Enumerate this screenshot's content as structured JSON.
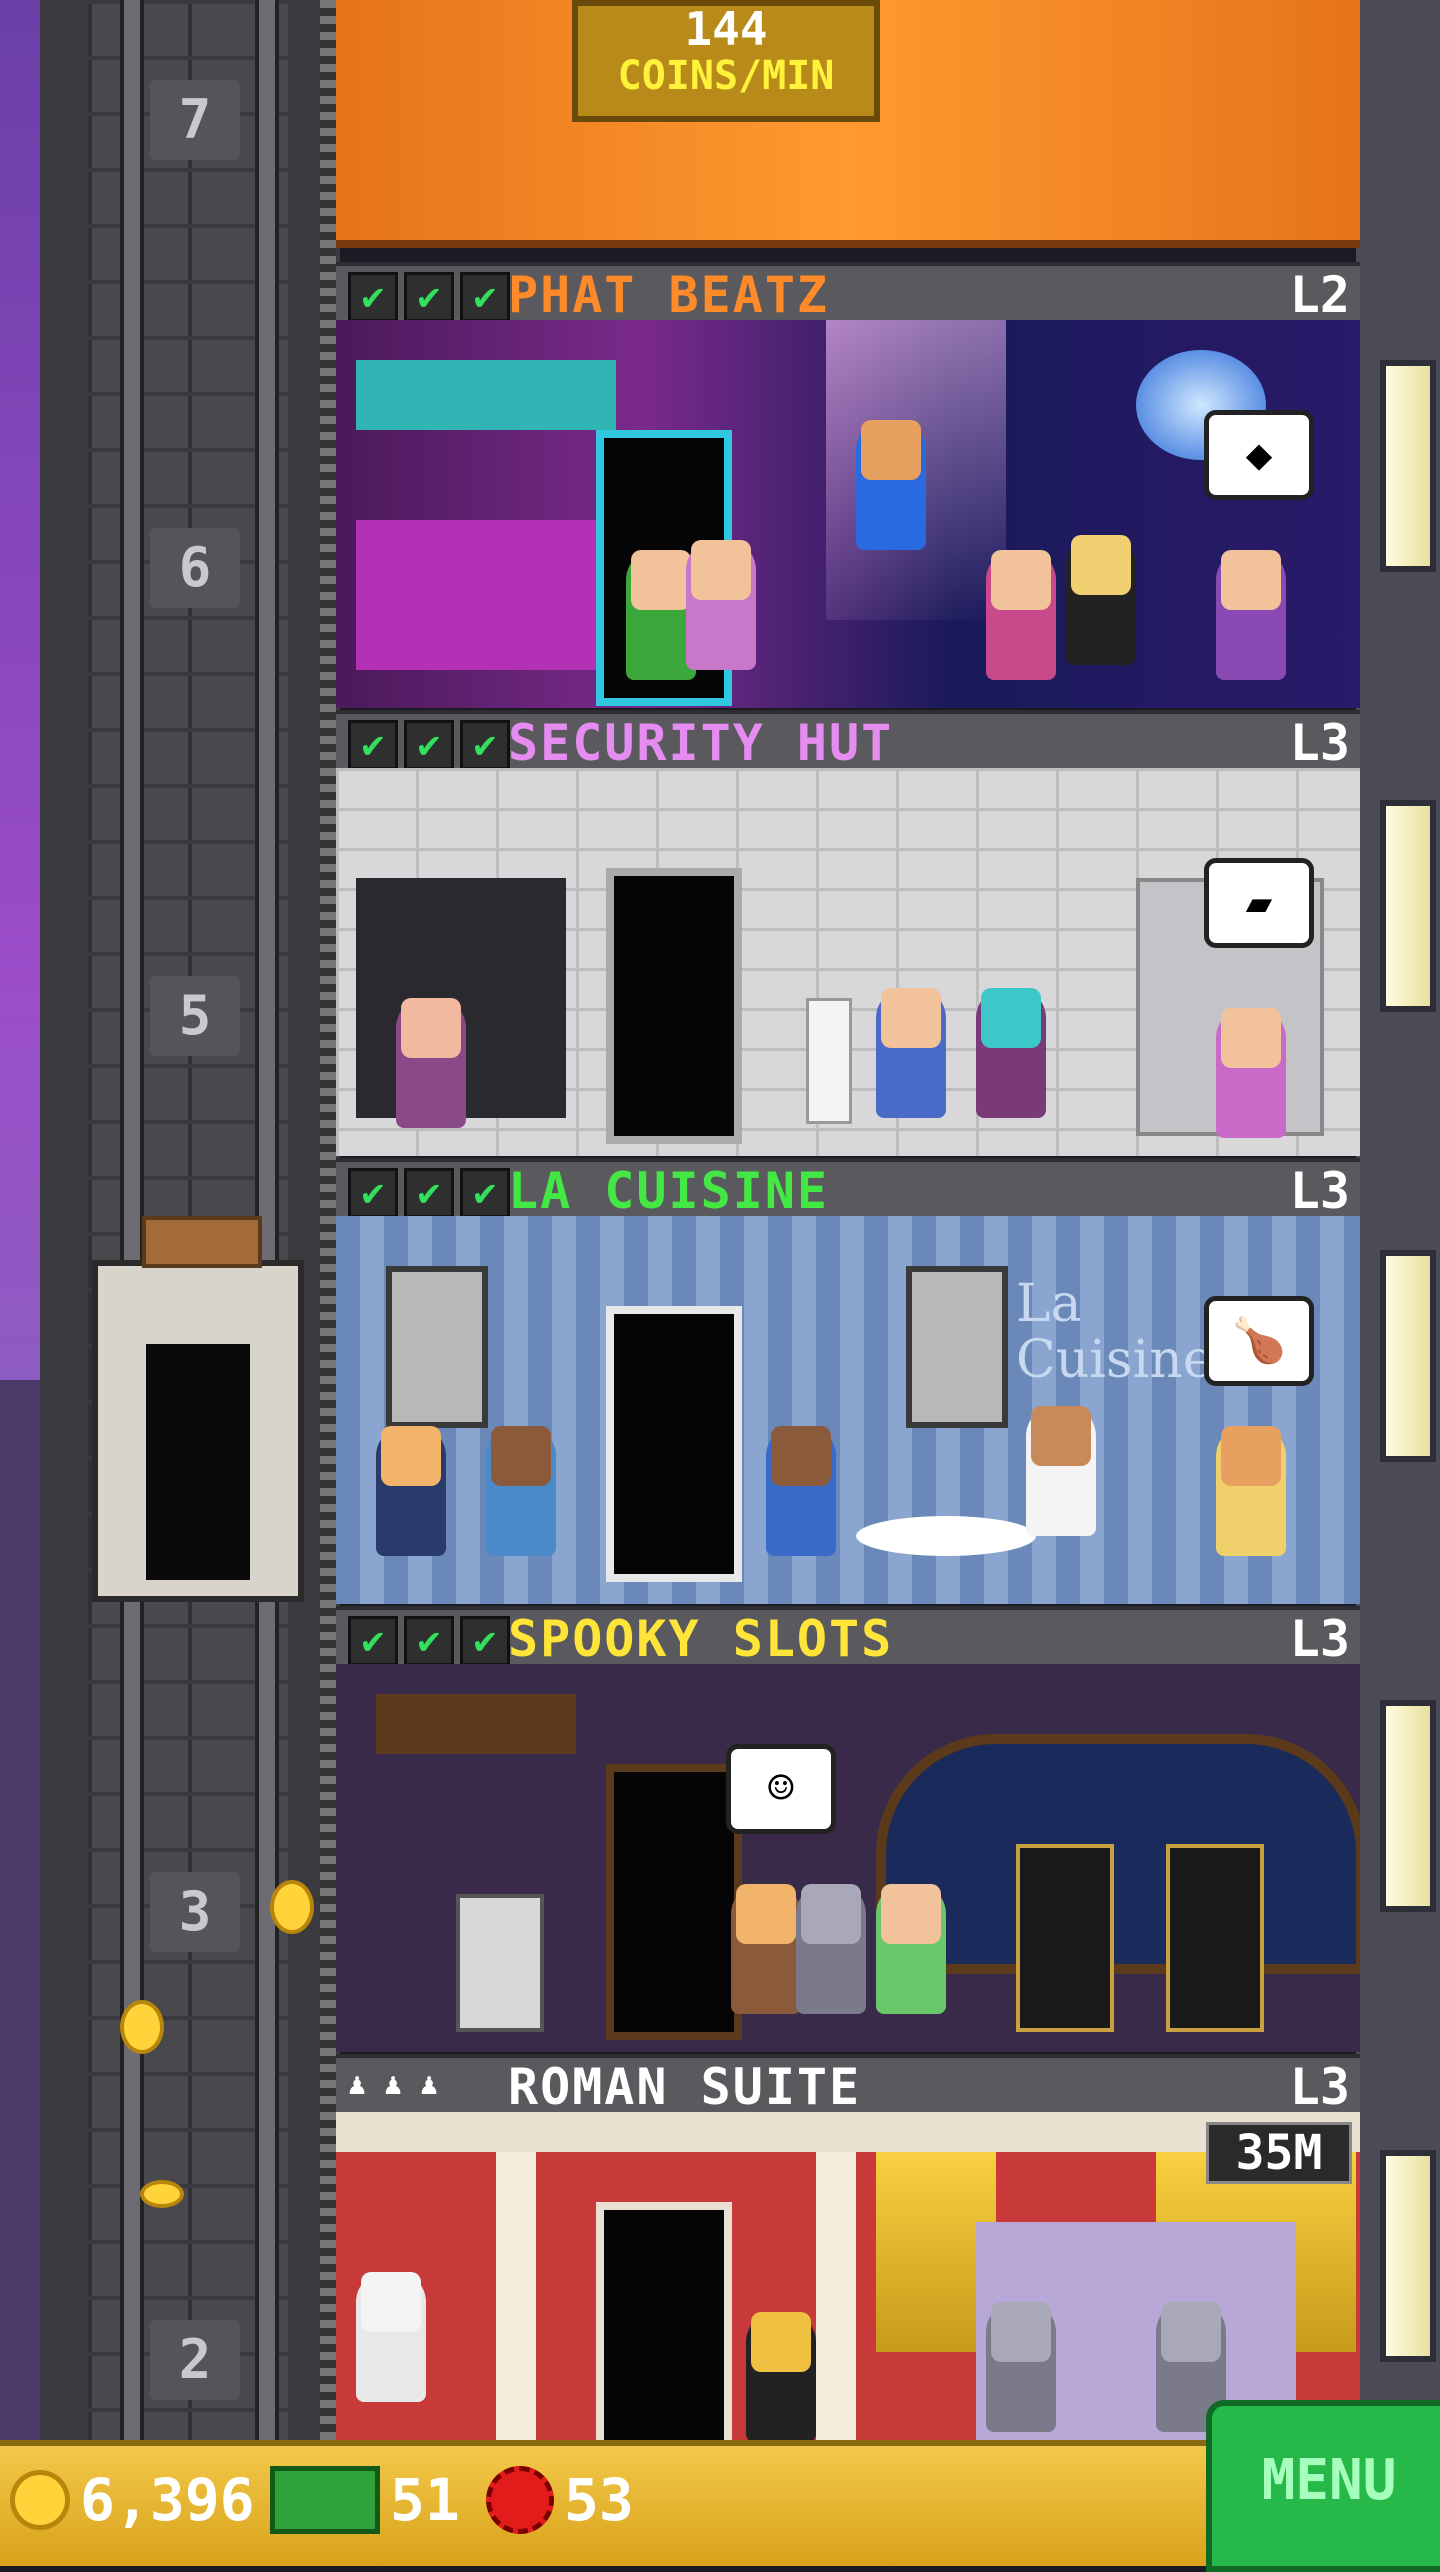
{
  "top_sign": {
    "amount": "144",
    "unit": "COINS/MIN"
  },
  "shaft": {
    "floor_numbers": [
      "7",
      "6",
      "5",
      "3",
      "2"
    ]
  },
  "floors": [
    {
      "name": "PHAT BEATZ",
      "level": "L2",
      "title_color": "#ff8a2a",
      "stocked": 3
    },
    {
      "name": "SECURITY HUT",
      "level": "L3",
      "title_color": "#e58cf0",
      "stocked": 3
    },
    {
      "name": "LA CUISINE",
      "level": "L3",
      "title_color": "#44e844",
      "stocked": 3
    },
    {
      "name": "SPOOKY SLOTS",
      "level": "L3",
      "title_color": "#ffe43a",
      "stocked": 3
    },
    {
      "name": "ROMAN SUITE",
      "level": "L3",
      "title_color": "#ffffff",
      "residents": 3,
      "elevator_price": "35M"
    }
  ],
  "check_mark": "✔",
  "resident_icon": "♟",
  "bubbles": {
    "phat_beatz": "◆",
    "security_hut": "▰",
    "la_cuisine": "🍗",
    "spooky_slots": "☺"
  },
  "la_cuisine_sign": "La Cuisine",
  "hud": {
    "coins": "6,396",
    "tower_bux": "51",
    "gems": "53",
    "menu_label": "MENU"
  },
  "colors": {
    "accent_green": "#27b84a",
    "bar_gold": "#f2c84a"
  }
}
